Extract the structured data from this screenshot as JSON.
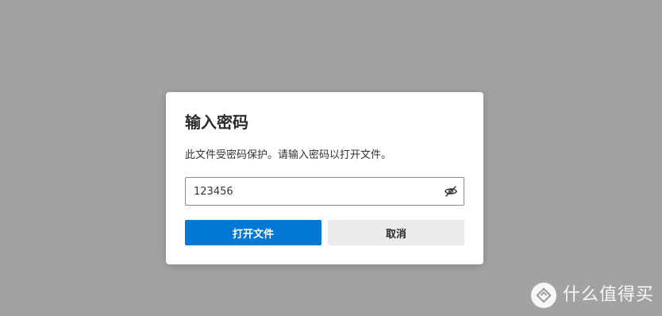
{
  "dialog": {
    "title": "输入密码",
    "message": "此文件受密码保护。请输入密码以打开文件。",
    "password_value": "123456",
    "open_label": "打开文件",
    "cancel_label": "取消"
  },
  "icons": {
    "password_toggle": "eye-slash-icon",
    "watermark_logo": "smzdm-logo-icon"
  },
  "watermark": {
    "text": "什么值得买"
  },
  "colors": {
    "backdrop": "#a2a2a2",
    "primary": "#0078d4",
    "secondary": "#ebebeb"
  }
}
